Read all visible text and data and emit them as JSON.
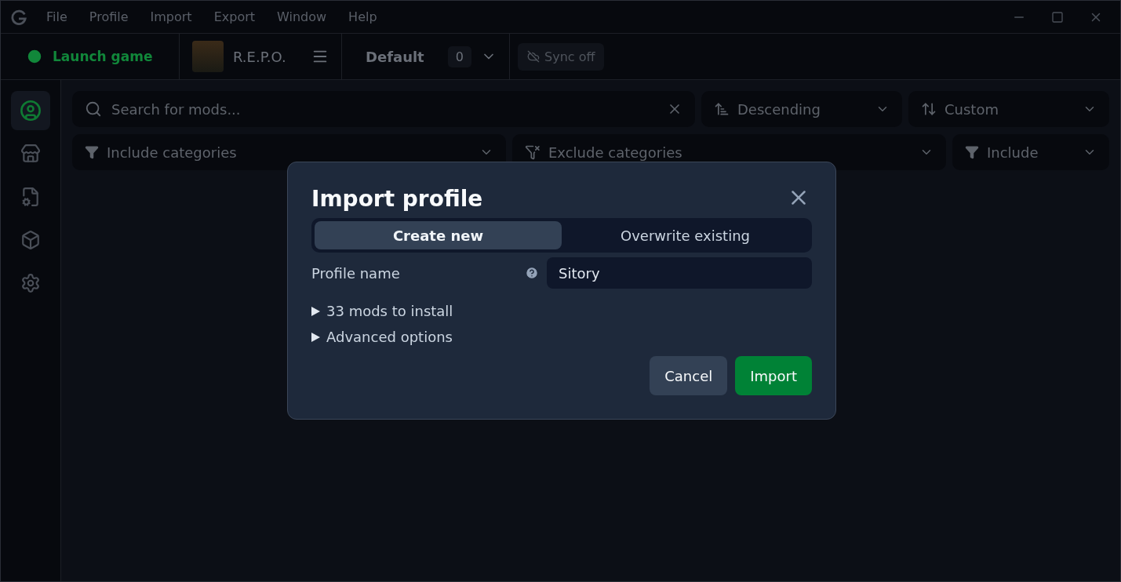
{
  "menu": [
    "File",
    "Profile",
    "Import",
    "Export",
    "Window",
    "Help"
  ],
  "toolbar": {
    "launch": "Launch game",
    "game": "R.E.P.O.",
    "profile": "Default",
    "profile_count": "0",
    "sync": "Sync off"
  },
  "sidebar": {
    "items": [
      {
        "kind": "profile",
        "selected": true
      },
      {
        "kind": "browse",
        "selected": false
      },
      {
        "kind": "config",
        "selected": false
      },
      {
        "kind": "modpack",
        "selected": false
      },
      {
        "kind": "settings",
        "selected": false
      }
    ]
  },
  "search": {
    "placeholder": "Search for mods..."
  },
  "sort_order": "Descending",
  "sort_by": "Custom",
  "include_categories": "Include categories",
  "exclude_categories": "Exclude categories",
  "filter_mode": "Include",
  "dialog": {
    "title": "Import profile",
    "tabs": [
      {
        "label": "Create new",
        "selected": true
      },
      {
        "label": "Overwrite existing",
        "selected": false
      }
    ],
    "field": {
      "label": "Profile name",
      "value": "Sitory"
    },
    "sections": [
      {
        "label": "33 mods to install",
        "expanded": false
      },
      {
        "label": "Advanced options",
        "expanded": false
      }
    ],
    "buttons": [
      {
        "label": "Cancel",
        "kind": "secondary"
      },
      {
        "label": "Import",
        "kind": "primary"
      }
    ]
  }
}
